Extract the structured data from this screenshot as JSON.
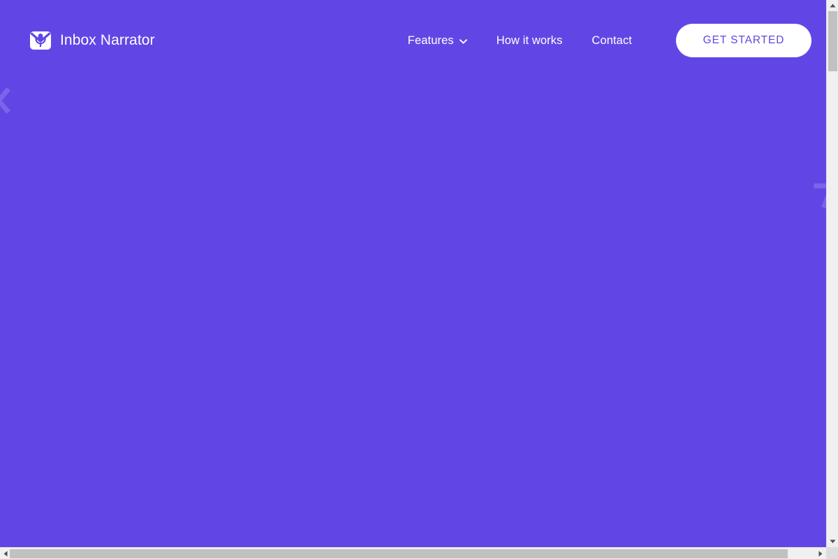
{
  "site": {
    "brand_name": "Inbox Narrator",
    "brand_icon": "envelope-microphone-icon",
    "background_color": "#6246E5",
    "accent_color": "#6246E5",
    "text_color": "#FFFFFF"
  },
  "header": {
    "nav": [
      {
        "label": "Features",
        "has_dropdown": true,
        "dropdown_icon": "chevron-down-icon"
      },
      {
        "label": "How it works",
        "has_dropdown": false
      },
      {
        "label": "Contact",
        "has_dropdown": false
      }
    ],
    "cta": {
      "label": "GET STARTED",
      "background": "#FFFFFF",
      "text_color": "#6246E5"
    }
  },
  "main": {
    "body_text": "",
    "decorations": [
      {
        "name": "chevron-left-shape",
        "icon": "chevron-left-icon"
      },
      {
        "name": "corner-bracket-shape",
        "icon": "corner-bracket-icon"
      }
    ]
  },
  "browser": {
    "vertical_scrollbar": {
      "up_arrow_icon": "scroll-up-arrow-icon",
      "down_arrow_icon": "scroll-down-arrow-icon",
      "thumb_color": "#C1C1C1",
      "track_color": "#F0F0F0"
    },
    "horizontal_scrollbar": {
      "left_arrow_icon": "scroll-left-arrow-icon",
      "right_arrow_icon": "scroll-right-arrow-icon",
      "thumb_color": "#C1C1C1",
      "track_color": "#F0F0F0"
    }
  }
}
